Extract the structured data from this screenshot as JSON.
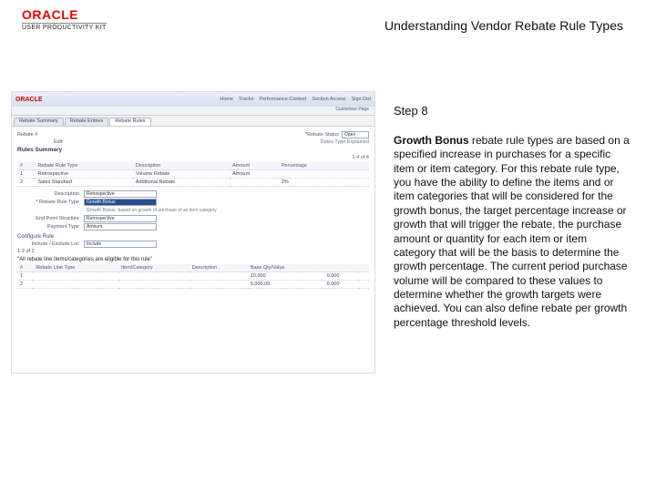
{
  "header": {
    "brand": "ORACLE",
    "subbrand": "USER PRODUCTIVITY KIT",
    "title": "Understanding Vendor Rebate Rule Types"
  },
  "right": {
    "step": "Step 8",
    "bold": "Growth Bonus",
    "body": " rebate rule types are based on a specified increase in purchases for a specific item or item category. For this rebate rule type, you have the ability to define the items and or item categories that will be considered for the growth bonus, the target percentage increase or growth that will trigger the rebate, the purchase amount or quantity for each item or item category that will be the basis to determine the growth percentage. The current period purchase volume will be compared to these values to determine whether the growth targets were achieved. You can also define rebate per growth percentage threshold levels."
  },
  "ss": {
    "logo": "ORACLE",
    "nav": [
      "Home",
      "Tracks",
      "Performance Context",
      "Section Access",
      "Sign Out"
    ],
    "row2": "Customize Page",
    "tabs": [
      "Rebate Summary",
      "Rebate Entries",
      "Rebate Rules"
    ],
    "rebate_label": "Rebate #",
    "edit_label": "Edit",
    "status_label": "*Rebate Status",
    "status_value": "Open",
    "dates_label": "Dates Type Explained",
    "rules_heading": "Rules Summary",
    "range": "1-4 of 4",
    "cols": [
      "#",
      "Rebate Rule Type",
      "Description",
      "Amount",
      "Percentage",
      "",
      ""
    ],
    "rows": [
      [
        "1",
        "Retrospective",
        "Volume Rebate",
        "Amount",
        "",
        "",
        ""
      ],
      [
        "2",
        "Sales Standard",
        "Additional Rebate",
        "",
        "2%",
        "",
        ""
      ]
    ],
    "field_desc": "Description",
    "field_desc_val": "Retrospective",
    "field_rrt": "* Rebate Rule Type",
    "field_rrt_val": "Growth Bonus",
    "note": "Growth Bonus: based on growth of purchase of an item category",
    "field_eps": "End Point Structure",
    "field_eps_val": "Retrospective",
    "field_pt": "Payment Type",
    "field_pt_val": "Amount",
    "cfg_heading": "Configure Rule",
    "loc_label": "Include / Exclude Loc",
    "loc_val": "Include",
    "pager2": "1-2 of 2",
    "quote": "\"All rebate line items/categories are eligible for this rule\"",
    "cols2": [
      "#",
      "Rebate Line Type",
      "Item/Category",
      "Description",
      "Base Qty/Value",
      "",
      ""
    ],
    "rows2": [
      [
        "1",
        "",
        "",
        "",
        "10,000",
        "0.000",
        ""
      ],
      [
        "2",
        "",
        "",
        "",
        "5,000.00",
        "0.000",
        ""
      ]
    ]
  }
}
